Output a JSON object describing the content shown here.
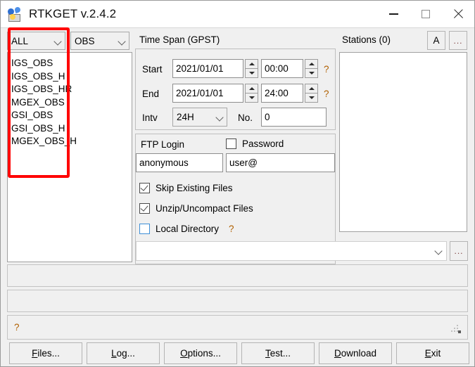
{
  "window": {
    "title": "RTKGET v.2.4.2",
    "icon": "satellite-antenna-icon",
    "controls": {
      "minimize": "minimize-icon",
      "maximize": "maximize-icon",
      "close": "close-icon"
    }
  },
  "left_panel": {
    "type_combo": {
      "value": "ALL"
    },
    "data_combo": {
      "value": "OBS"
    },
    "list_items": [
      "IGS_OBS",
      "IGS_OBS_H",
      "IGS_OBS_HR",
      "MGEX_OBS",
      "GSI_OBS",
      "GSI_OBS_H",
      "MGEX_OBS_H"
    ]
  },
  "time_span": {
    "title": "Time Span (GPST)",
    "start_label": "Start",
    "start_date": "2021/01/01",
    "start_time": "00:00",
    "start_help": "?",
    "end_label": "End",
    "end_date": "2021/01/01",
    "end_time": "24:00",
    "end_help": "?",
    "intv_label": "Intv",
    "intv_value": "24H",
    "no_label": "No.",
    "no_value": "0"
  },
  "ftp": {
    "login_label": "FTP Login",
    "password_label": "Password",
    "password_checked": false,
    "user_value": "anonymous",
    "password_value": "user@",
    "skip_existing_label": "Skip Existing Files",
    "skip_existing_checked": true,
    "unzip_label": "Unzip/Uncompact Files",
    "unzip_checked": true,
    "local_dir_label": "Local Directory",
    "local_dir_checked": false,
    "local_dir_help": "?"
  },
  "stations": {
    "title": "Stations (0)",
    "btn_a": "A",
    "btn_more": "..."
  },
  "path": {
    "value": "",
    "browse_label": "..."
  },
  "status": {
    "help": "?",
    "grip": "resize-grip-icon"
  },
  "buttons": [
    {
      "name": "files",
      "pre": "",
      "mnemonic": "F",
      "post": "iles..."
    },
    {
      "name": "log",
      "pre": "",
      "mnemonic": "L",
      "post": "og..."
    },
    {
      "name": "options",
      "pre": "",
      "mnemonic": "O",
      "post": "ptions..."
    },
    {
      "name": "test",
      "pre": "",
      "mnemonic": "T",
      "post": "est..."
    },
    {
      "name": "download",
      "pre": "",
      "mnemonic": "D",
      "post": "ownload"
    },
    {
      "name": "exit",
      "pre": "",
      "mnemonic": "E",
      "post": "xit"
    }
  ],
  "annotation": {
    "type": "red-highlight-rectangle",
    "color": "#ff0000"
  }
}
